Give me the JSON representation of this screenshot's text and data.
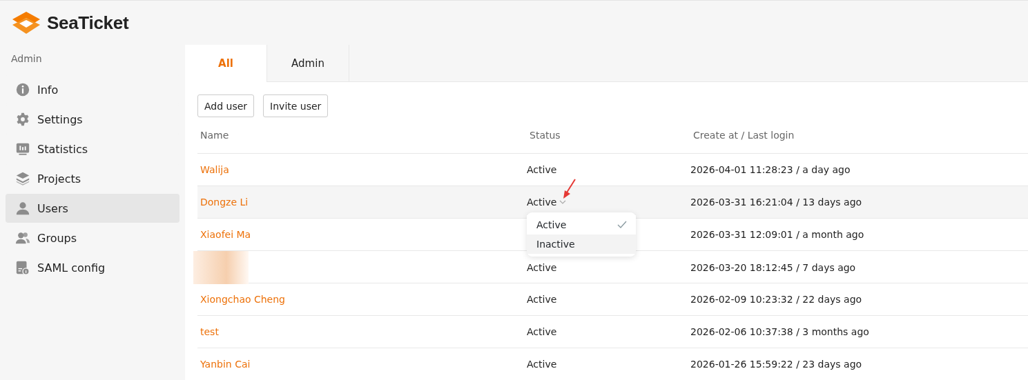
{
  "brand": {
    "name": "SeaTicket"
  },
  "sidebar": {
    "heading": "Admin",
    "items": [
      {
        "label": "Info",
        "selected": false
      },
      {
        "label": "Settings",
        "selected": false
      },
      {
        "label": "Statistics",
        "selected": false
      },
      {
        "label": "Projects",
        "selected": false
      },
      {
        "label": "Users",
        "selected": true
      },
      {
        "label": "Groups",
        "selected": false
      },
      {
        "label": "SAML config",
        "selected": false
      }
    ]
  },
  "tabs": [
    {
      "label": "All",
      "selected": true
    },
    {
      "label": "Admin",
      "selected": false
    }
  ],
  "buttons": [
    "Add user",
    "Invite user"
  ],
  "table": {
    "columns": [
      "Name",
      "Status",
      "Create at / Last login"
    ],
    "rows": [
      {
        "name": "Walija",
        "status": "Active",
        "created": "2026-04-01 11:28:23 / a day ago",
        "highlighted": false,
        "redacted": false
      },
      {
        "name": "Dongze Li",
        "status": "Active",
        "created": "2026-03-31 16:21:04 / 13 days ago",
        "highlighted": true,
        "redacted": false,
        "dropdown": {
          "items": [
            {
              "label": "Active",
              "selected": true,
              "highlighted": false
            },
            {
              "label": "Inactive",
              "selected": false,
              "highlighted": true
            }
          ]
        }
      },
      {
        "name": "Xiaofei Ma",
        "created": "2026-03-31 12:09:01 / a month ago",
        "highlighted": false,
        "redacted": false
      },
      {
        "status": "Active",
        "created": "2026-03-20 18:12:45 / 7 days ago",
        "highlighted": false,
        "redacted": true
      },
      {
        "name": "Xiongchao Cheng",
        "status": "Active",
        "created": "2026-02-09 10:23:32 / 22 days ago",
        "highlighted": false,
        "redacted": false
      },
      {
        "name": "test",
        "status": "Active",
        "created": "2026-02-06 10:37:38 / 3 months ago",
        "highlighted": false,
        "redacted": false
      },
      {
        "name": "Yanbin Cai",
        "status": "Active",
        "created": "2026-01-26 15:59:22 / 23 days ago",
        "highlighted": false,
        "redacted": false
      }
    ]
  }
}
